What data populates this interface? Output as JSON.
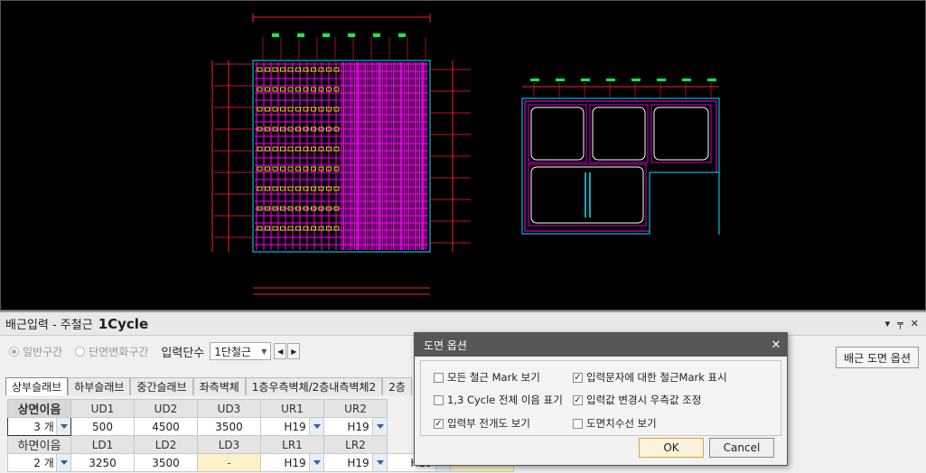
{
  "panel": {
    "title_prefix": "배근입력 - 주철근",
    "title_cycle": "1Cycle",
    "ctrl_down": "▾",
    "ctrl_pin": "╤",
    "ctrl_close": "✕"
  },
  "toolbar": {
    "radio_general": "일반구간",
    "radio_section": "단면변화구간",
    "input_stage_label": "입력단수",
    "input_stage_value": "1단철근",
    "spin_left": "◀",
    "spin_right": "▶",
    "drawing_option_button": "배근 도면 옵션"
  },
  "tabs": [
    "상부슬래브",
    "하부슬래브",
    "중간슬래브",
    "좌측벽체",
    "1층우측벽체/2층내측벽체2",
    "2층"
  ],
  "grid": {
    "row1_headers": [
      "상면이음",
      "UD1",
      "UD2",
      "UD3",
      "UR1",
      "UR2"
    ],
    "row2_values": [
      "3 개",
      "500",
      "4500",
      "3500",
      "H19",
      "H19"
    ],
    "row3_headers": [
      "하면이음",
      "LD1",
      "LD2",
      "LD3",
      "LR1",
      "LR2"
    ],
    "row4_values": [
      "2 개",
      "3250",
      "3500",
      "-",
      "H19",
      "H19"
    ],
    "row4_extra": [
      "H19",
      ""
    ]
  },
  "dialog": {
    "title": "도면 옵션",
    "close": "✕",
    "options": {
      "all_mark": "모든 철근 Mark 보기",
      "cycle_splice": "1,3 Cycle 전체 이음 표기",
      "input_full": "입력부 전개도 보기",
      "input_text_mark": "입력문자에 대한 철근Mark 표시",
      "right_adjust": "입력값 변경시 우측값 조정",
      "dim_line": "도면치수선 보기"
    },
    "checked_mark": "✓",
    "ok": "OK",
    "cancel": "Cancel"
  },
  "colors": {
    "canvas_bg": "#000000",
    "rebar_magenta": "#ff00ff",
    "outline_cyan": "#00e5ff",
    "dimension_red": "#ff2020",
    "text_yellow": "#ffff00",
    "text_green": "#00ff44"
  }
}
